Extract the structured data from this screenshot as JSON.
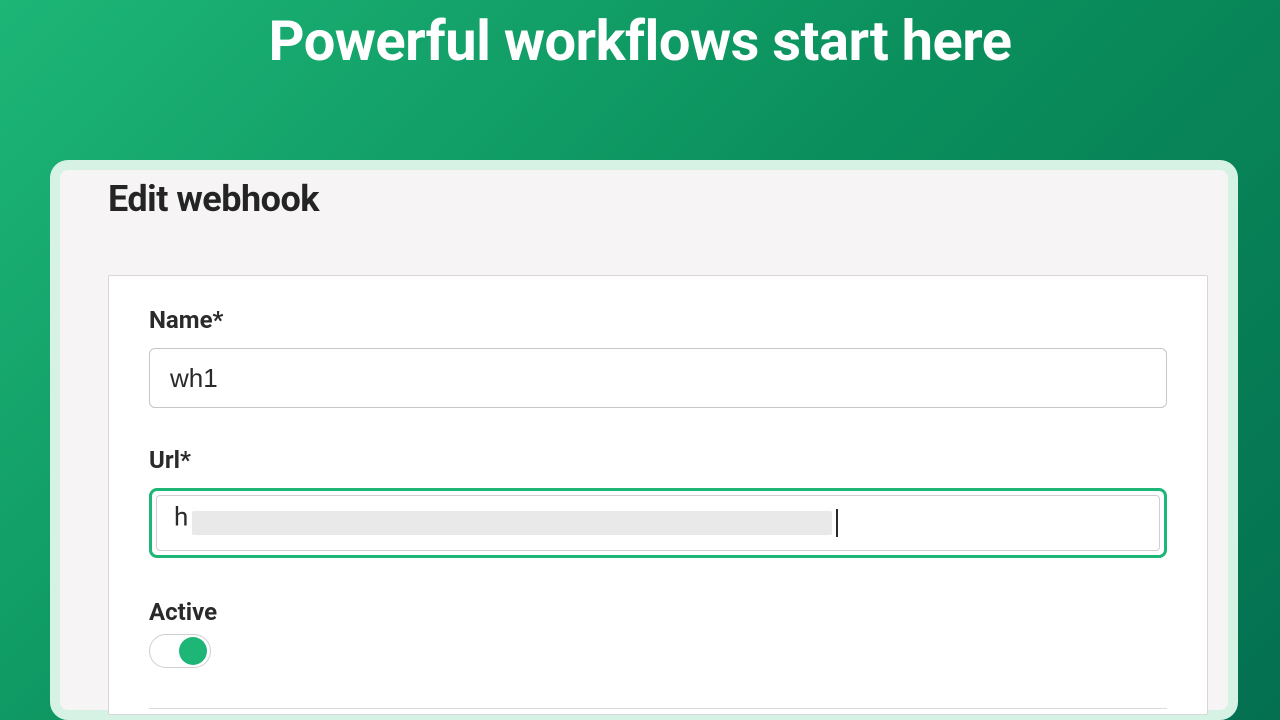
{
  "hero": {
    "title": "Powerful workflows start here"
  },
  "panel": {
    "title": "Edit webhook"
  },
  "form": {
    "name": {
      "label": "Name*",
      "value": "wh1"
    },
    "url": {
      "label": "Url*",
      "leading_char": "h"
    },
    "active": {
      "label": "Active",
      "state": "on"
    }
  },
  "colors": {
    "accent": "#1db677"
  }
}
